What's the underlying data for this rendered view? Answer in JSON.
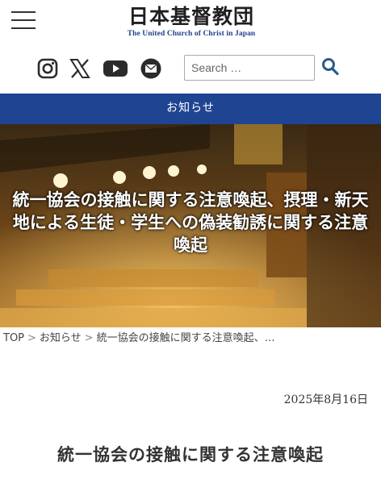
{
  "header": {
    "logo_jp": "日本基督教団",
    "logo_en": "The United Church of Christ in Japan"
  },
  "social": {
    "icons": [
      "instagram-icon",
      "x-icon",
      "youtube-icon",
      "mail-icon"
    ]
  },
  "search": {
    "placeholder": "Search …"
  },
  "nav": {
    "label": "お知らせ"
  },
  "hero": {
    "title": "統一協会の接触に関する注意喚起、摂理・新天地による生徒・学生への偽装勧誘に関する注意喚起"
  },
  "breadcrumb": {
    "home": "TOP",
    "section": "お知らせ",
    "current": "統一協会の接触に関する注意喚起、…",
    "separator": ">"
  },
  "article": {
    "date": "2025年8月16日",
    "title": "統一協会の接触に関する注意喚起"
  },
  "colors": {
    "brand_blue": "#1f4592",
    "logo_blue": "#1f3f8a",
    "icon_dark": "#2b2b2b",
    "search_icon": "#2a5a8a"
  }
}
